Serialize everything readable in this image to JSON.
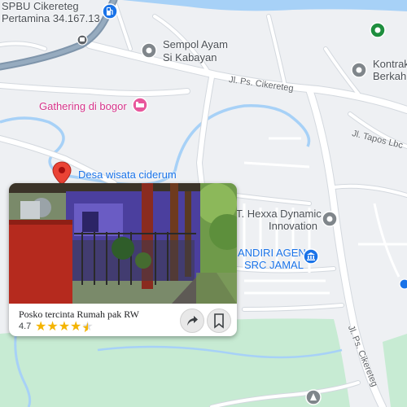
{
  "map": {
    "labels": {
      "spbu_line1": "SPBU Cikereteg",
      "spbu_line2": "Pertamina 34.167.13",
      "sempol_line1": "Sempol Ayam",
      "sempol_line2": "Si Kabayan",
      "kontrak_line1": "Kontrak",
      "kontrak_line2": "Berkah",
      "gathering": "Gathering di bogor",
      "desa_wisata": "Desa wisata ciderum",
      "hexxa_line1": "T. Hexxa Dynamic",
      "hexxa_line2": "Innovation",
      "agen_line1": "ANDIRI AGEN",
      "agen_line2": "SRC JAMAL",
      "road_ps_cikereteg_top": "Jl. Ps. Cikereteg",
      "road_tapos": "Jl. Tapos Lbc",
      "road_ps_cikereteg_bottom": "Jl. Ps. Cikereteg"
    },
    "icons": {
      "fuel": "gas-station-icon",
      "pin_generic": "place-pin-icon",
      "bed": "lodging-icon",
      "bank": "bank-icon",
      "green_pin": "green-place-pin-icon",
      "red_pin": "selected-location-pin-icon",
      "triangle": "landmark-icon"
    },
    "colors": {
      "water": "#a7d1f7",
      "park": "#c7ebd3",
      "road": "#ffffff",
      "road_edge": "#d3d8de",
      "highway": "#7f95ab",
      "background": "#eef0f3"
    }
  },
  "card": {
    "title": "Posko tercinta Rumah pak RW",
    "rating": "4.7",
    "rating_value": 4.7,
    "stars_max": 5
  }
}
